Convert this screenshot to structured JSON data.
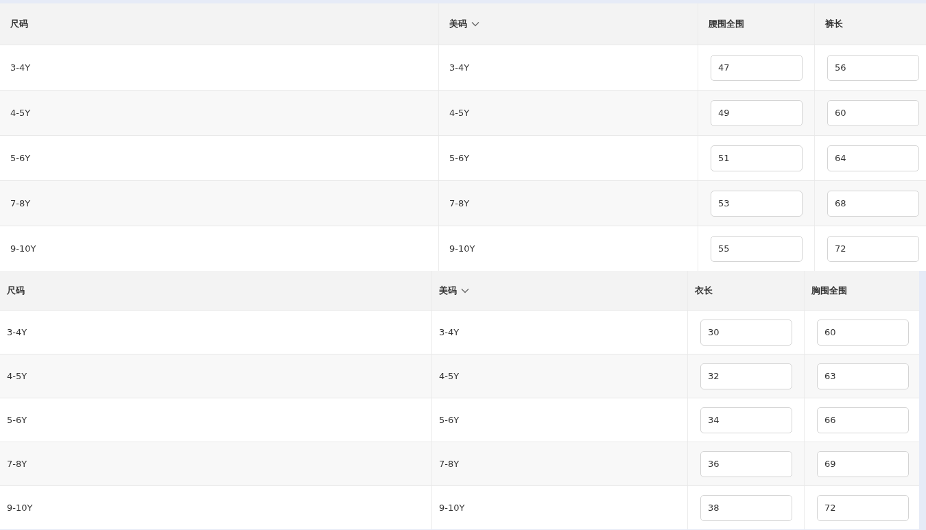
{
  "tables": [
    {
      "columns": [
        {
          "label": "尺码",
          "dropdown": false
        },
        {
          "label": "美码",
          "dropdown": true
        },
        {
          "label": "腰围全围",
          "dropdown": false
        },
        {
          "label": "裤长",
          "dropdown": false
        }
      ],
      "rows": [
        {
          "size": "3-4Y",
          "us_size": "3-4Y",
          "values": [
            "47",
            "56"
          ]
        },
        {
          "size": "4-5Y",
          "us_size": "4-5Y",
          "values": [
            "49",
            "60"
          ]
        },
        {
          "size": "5-6Y",
          "us_size": "5-6Y",
          "values": [
            "51",
            "64"
          ]
        },
        {
          "size": "7-8Y",
          "us_size": "7-8Y",
          "values": [
            "53",
            "68"
          ]
        },
        {
          "size": "9-10Y",
          "us_size": "9-10Y",
          "values": [
            "55",
            "72"
          ]
        }
      ]
    },
    {
      "columns": [
        {
          "label": "尺码",
          "dropdown": false
        },
        {
          "label": "美码",
          "dropdown": true
        },
        {
          "label": "衣长",
          "dropdown": false
        },
        {
          "label": "胸围全围",
          "dropdown": false
        }
      ],
      "rows": [
        {
          "size": "3-4Y",
          "us_size": "3-4Y",
          "values": [
            "30",
            "60"
          ]
        },
        {
          "size": "4-5Y",
          "us_size": "4-5Y",
          "values": [
            "32",
            "63"
          ]
        },
        {
          "size": "5-6Y",
          "us_size": "5-6Y",
          "values": [
            "34",
            "66"
          ]
        },
        {
          "size": "7-8Y",
          "us_size": "7-8Y",
          "values": [
            "36",
            "69"
          ]
        },
        {
          "size": "9-10Y",
          "us_size": "9-10Y",
          "values": [
            "38",
            "72"
          ]
        }
      ]
    }
  ]
}
